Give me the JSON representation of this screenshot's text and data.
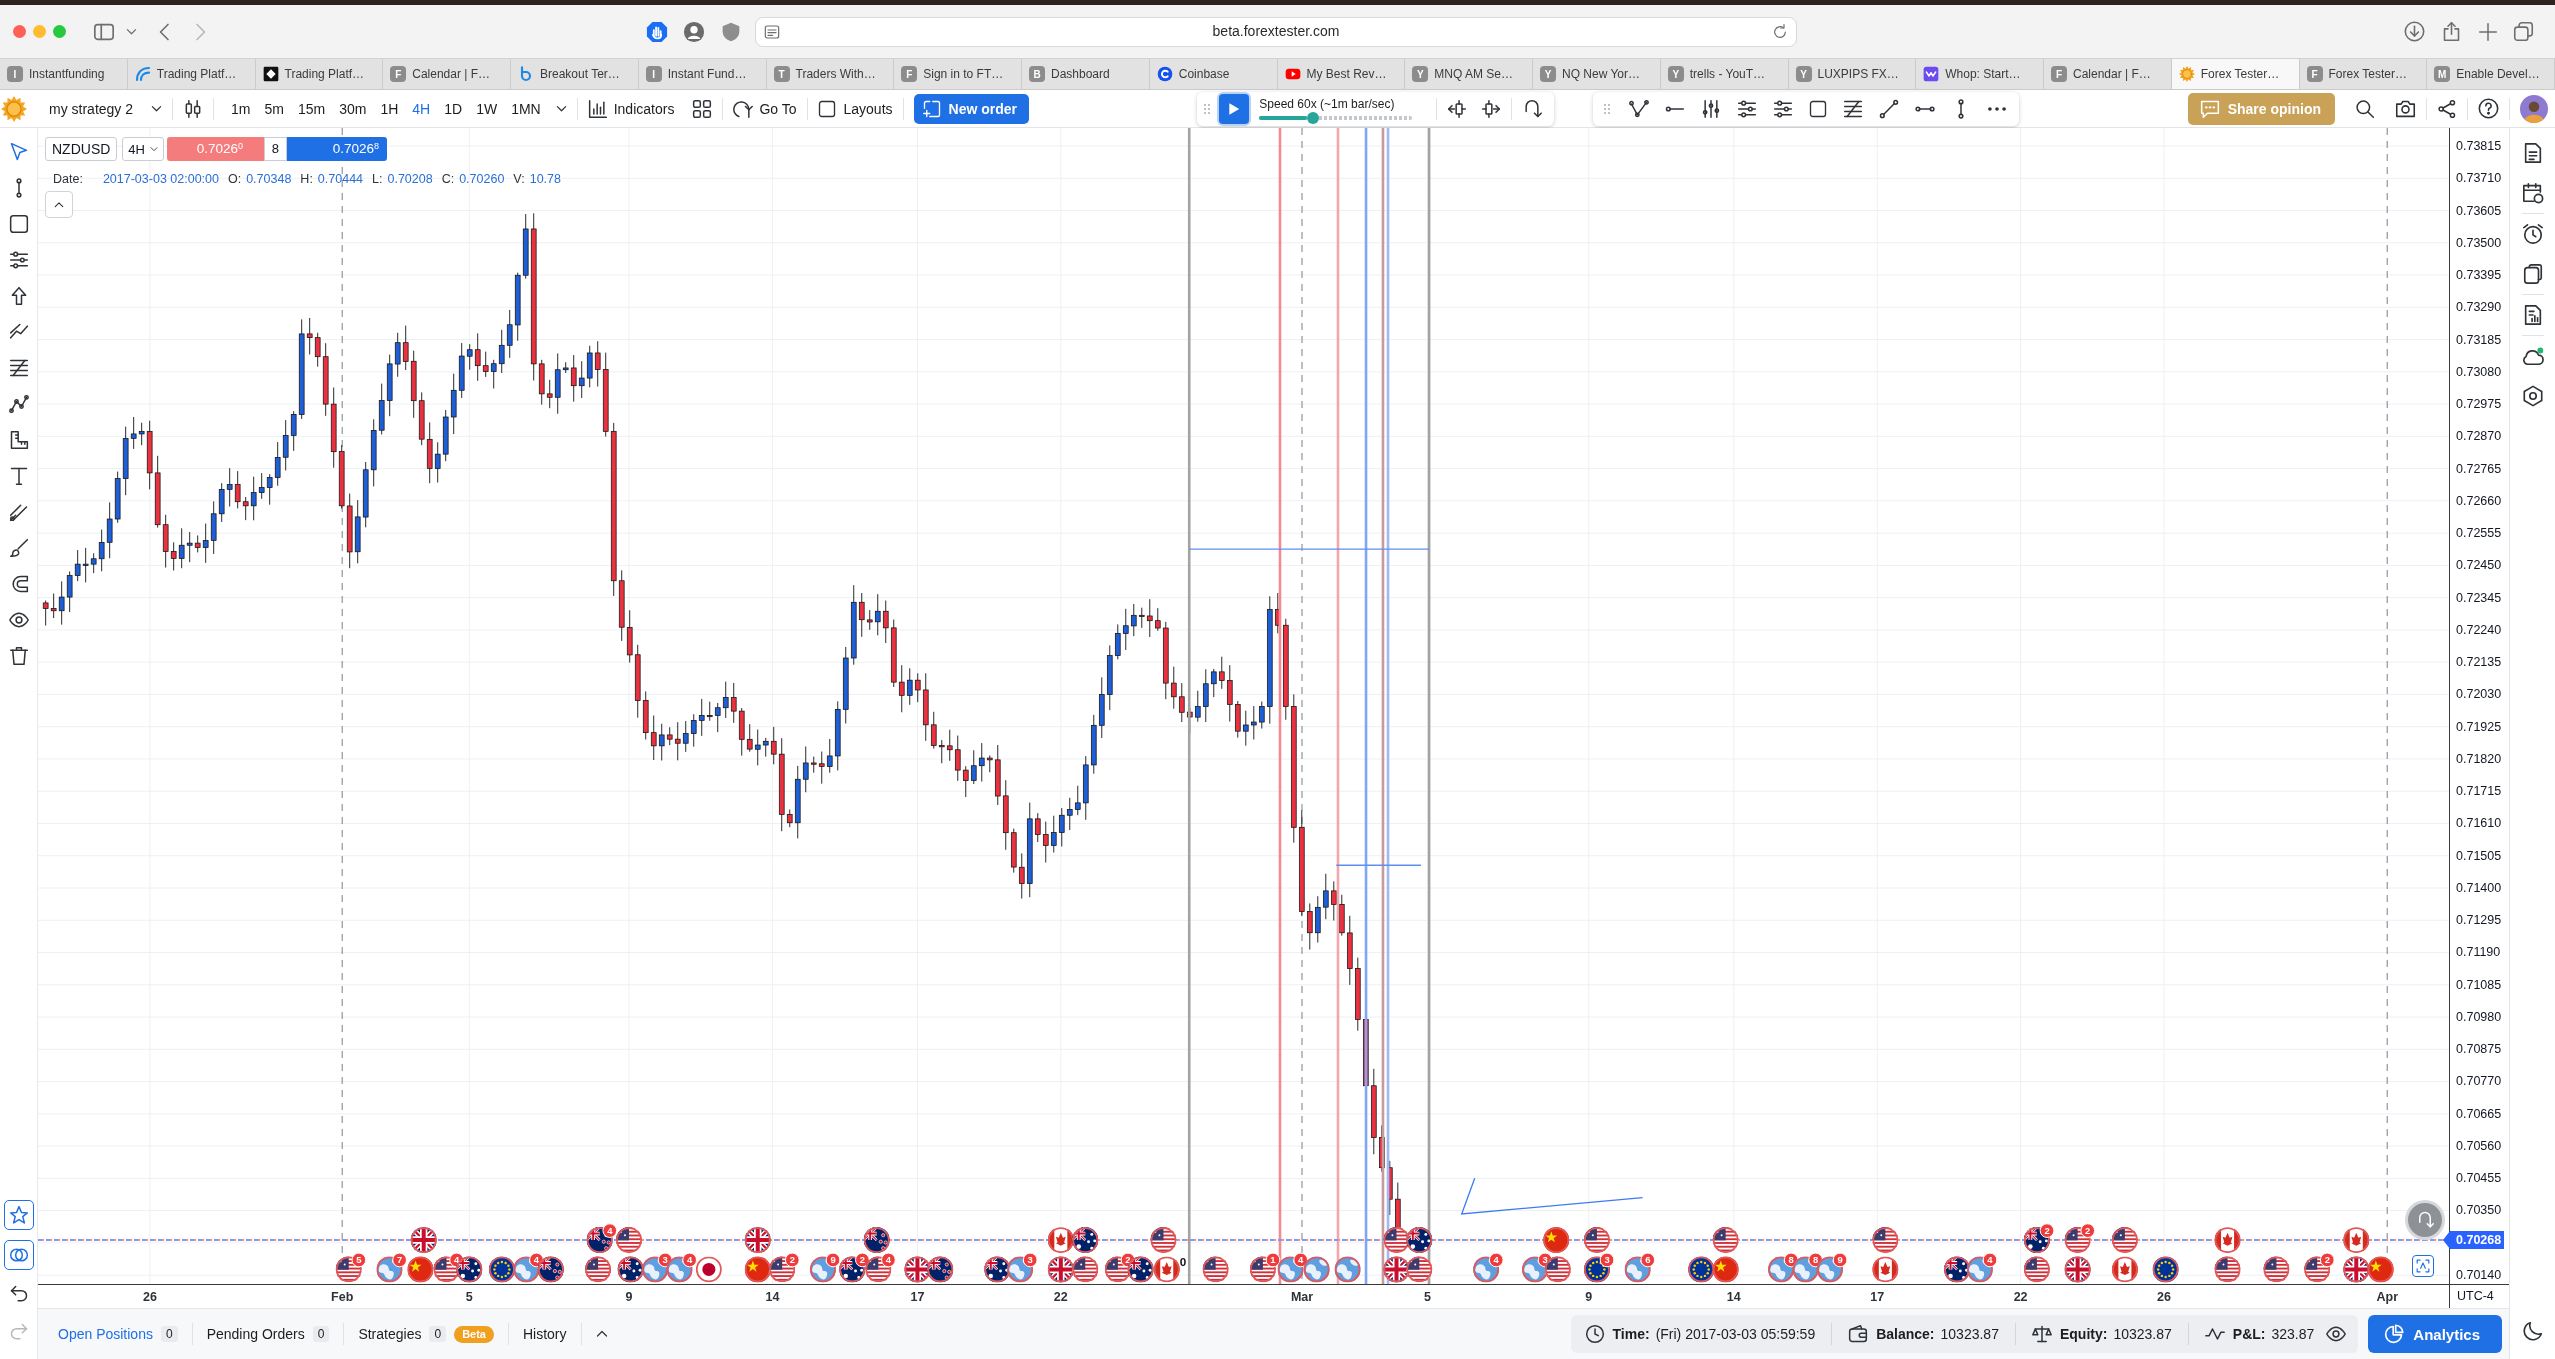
{
  "browser": {
    "address": "beta.forextester.com",
    "tabs": [
      {
        "label": "Instantfunding",
        "kind": "letter",
        "favicon_letter": "I",
        "selected": false
      },
      {
        "label": "Trading Platf…",
        "kind": "logo",
        "selected": false
      },
      {
        "label": "Trading Platf…",
        "kind": "logo",
        "selected": false
      },
      {
        "label": "Calendar | F…",
        "kind": "letter",
        "favicon_letter": "F",
        "selected": false
      },
      {
        "label": "Breakout Ter…",
        "kind": "logo",
        "selected": false
      },
      {
        "label": "Instant Fund…",
        "kind": "letter",
        "favicon_letter": "I",
        "selected": false
      },
      {
        "label": "Traders With…",
        "kind": "letter",
        "favicon_letter": "T",
        "selected": false
      },
      {
        "label": "Sign in to FT…",
        "kind": "letter",
        "favicon_letter": "F",
        "selected": false
      },
      {
        "label": "Dashboard",
        "kind": "letter",
        "favicon_letter": "B",
        "selected": false
      },
      {
        "label": "Coinbase",
        "kind": "logo",
        "selected": false
      },
      {
        "label": "My Best Rev…",
        "kind": "logo",
        "selected": false
      },
      {
        "label": "MNQ AM Se…",
        "kind": "letter",
        "favicon_letter": "Y",
        "selected": false
      },
      {
        "label": "NQ New Yor…",
        "kind": "letter",
        "favicon_letter": "Y",
        "selected": false
      },
      {
        "label": "trells - YouT…",
        "kind": "letter",
        "favicon_letter": "Y",
        "selected": false
      },
      {
        "label": "LUXPIPS FX…",
        "kind": "letter",
        "favicon_letter": "Y",
        "selected": false
      },
      {
        "label": "Whop: Start…",
        "kind": "logo",
        "selected": false
      },
      {
        "label": "Calendar | F…",
        "kind": "letter",
        "favicon_letter": "F",
        "selected": false
      },
      {
        "label": "Forex Tester…",
        "kind": "logo",
        "selected": true
      },
      {
        "label": "Forex Tester…",
        "kind": "letter",
        "favicon_letter": "F",
        "selected": false
      },
      {
        "label": "Enable Devel…",
        "kind": "letter",
        "favicon_letter": "M",
        "selected": false
      }
    ]
  },
  "toolbar": {
    "strategy": "my strategy 2",
    "timeframes": [
      {
        "label": "1m",
        "selected": false
      },
      {
        "label": "5m",
        "selected": false
      },
      {
        "label": "15m",
        "selected": false
      },
      {
        "label": "30m",
        "selected": false
      },
      {
        "label": "1H",
        "selected": false
      },
      {
        "label": "4H",
        "selected": true
      },
      {
        "label": "1D",
        "selected": false
      },
      {
        "label": "1W",
        "selected": false
      },
      {
        "label": "1MN",
        "selected": false
      }
    ],
    "indicators": "Indicators",
    "go_to": "Go To",
    "layouts": "Layouts",
    "new_order": "New order",
    "playback": {
      "speed": "Speed 60x (~1m bar/sec)",
      "level": 0.35
    },
    "share_opinion": "Share opinion"
  },
  "left_toolbar": {
    "tools": [
      {
        "selected": true
      },
      {
        "selected": false
      },
      {
        "selected": false
      },
      {
        "selected": false
      },
      {
        "selected": false
      },
      {
        "selected": false
      },
      {
        "selected": false
      },
      {
        "selected": false
      },
      {
        "selected": false
      },
      {
        "selected": false
      },
      {
        "selected": false
      },
      {
        "selected": false
      },
      {
        "selected": false
      },
      {
        "selected": false
      },
      {
        "selected": false
      }
    ],
    "toggles": [
      {
        "on": true
      },
      {
        "on": true
      }
    ],
    "history": [
      {
        "disabled": false
      },
      {
        "disabled": true
      }
    ]
  },
  "chart": {
    "symbol": "NZDUSD",
    "timeframe": "4H",
    "sell_price": "0.7026$^{0}$",
    "spread": "8",
    "buy_price": "0.7026$^{8}$",
    "ohlc": [
      {
        "label": "Date:",
        "value": "2017-03-03 02:00:00"
      },
      {
        "label": "O:",
        "value": "0.70348"
      },
      {
        "label": "H:",
        "value": "0.70444"
      },
      {
        "label": "L:",
        "value": "0.70208"
      },
      {
        "label": "C:",
        "value": "0.70260"
      },
      {
        "label": "V:",
        "value": "10.78"
      }
    ],
    "price_axis": [
      "0.73815",
      "0.73710",
      "0.73605",
      "0.73500",
      "0.73395",
      "0.73290",
      "0.73185",
      "0.73080",
      "0.72975",
      "0.72870",
      "0.72765",
      "0.72660",
      "0.72555",
      "0.72450",
      "0.72345",
      "0.72240",
      "0.72135",
      "0.72030",
      "0.71925",
      "0.71820",
      "0.71715",
      "0.71610",
      "0.71505",
      "0.71400",
      "0.71295",
      "0.71190",
      "0.71085",
      "0.70980",
      "0.70875",
      "0.70770",
      "0.70665",
      "0.70560",
      "0.70455",
      "0.70350",
      "0.70140"
    ],
    "current_price": "0.70268",
    "date_axis": [
      "26",
      "Feb",
      "5",
      "9",
      "14",
      "17",
      "22",
      "Mar",
      "5",
      "9",
      "14",
      "17",
      "22",
      "26",
      "Apr"
    ],
    "timezone": "UTC-4",
    "line_labels": [
      {
        "text": "0",
        "color": "#111111"
      }
    ],
    "events": {
      "upper_row": [
        {
          "kind": "uk"
        },
        {
          "kind": "nz",
          "count": "4"
        },
        {
          "kind": "us"
        },
        {
          "kind": "uk"
        },
        {
          "kind": "nz"
        },
        {
          "kind": "ca"
        },
        {
          "kind": "au"
        },
        {
          "kind": "us"
        },
        {
          "kind": "us"
        },
        {
          "kind": "au"
        },
        {
          "kind": "cn"
        },
        {
          "kind": "us"
        },
        {
          "kind": "us"
        },
        {
          "kind": "us"
        },
        {
          "kind": "au",
          "count": "2"
        },
        {
          "kind": "us",
          "count": "2"
        },
        {
          "kind": "us"
        },
        {
          "kind": "ca"
        },
        {
          "kind": "ca"
        }
      ],
      "lower_row": [
        {
          "kind": "us",
          "count": "5"
        },
        {
          "kind": "world",
          "count": "7"
        },
        {
          "kind": "cn"
        },
        {
          "kind": "us",
          "count": "4"
        },
        {
          "kind": "au"
        },
        {
          "kind": "eu"
        },
        {
          "kind": "world",
          "count": "4"
        },
        {
          "kind": "nz"
        },
        {
          "kind": "us"
        },
        {
          "kind": "au"
        },
        {
          "kind": "world",
          "count": "3"
        },
        {
          "kind": "world",
          "count": "4"
        },
        {
          "kind": "jp"
        },
        {
          "kind": "cn"
        },
        {
          "kind": "us",
          "count": "2"
        },
        {
          "kind": "world",
          "count": "9"
        },
        {
          "kind": "au",
          "count": "2"
        },
        {
          "kind": "us",
          "count": "4"
        },
        {
          "kind": "uk"
        },
        {
          "kind": "nz"
        },
        {
          "kind": "au"
        },
        {
          "kind": "world",
          "count": "3"
        },
        {
          "kind": "uk"
        },
        {
          "kind": "us"
        },
        {
          "kind": "us",
          "count": "2"
        },
        {
          "kind": "au"
        },
        {
          "kind": "ca"
        },
        {
          "kind": "us"
        },
        {
          "kind": "us",
          "count": "1"
        },
        {
          "kind": "world",
          "count": "4"
        },
        {
          "kind": "world"
        },
        {
          "kind": "world"
        },
        {
          "kind": "uk"
        },
        {
          "kind": "us"
        },
        {
          "kind": "world",
          "count": "4"
        },
        {
          "kind": "world",
          "count": "3"
        },
        {
          "kind": "us"
        },
        {
          "kind": "eu",
          "count": "3"
        },
        {
          "kind": "world",
          "count": "6"
        },
        {
          "kind": "eu"
        },
        {
          "kind": "cn"
        },
        {
          "kind": "world",
          "count": "8"
        },
        {
          "kind": "world",
          "count": "8"
        },
        {
          "kind": "world",
          "count": "9"
        },
        {
          "kind": "ca"
        },
        {
          "kind": "au"
        },
        {
          "kind": "world",
          "count": "4"
        },
        {
          "kind": "us"
        },
        {
          "kind": "uk"
        },
        {
          "kind": "ca"
        },
        {
          "kind": "eu"
        },
        {
          "kind": "us"
        },
        {
          "kind": "us"
        },
        {
          "kind": "us",
          "count": "2"
        },
        {
          "kind": "uk"
        },
        {
          "kind": "cn"
        }
      ]
    }
  },
  "bottom_bar": {
    "tabs": [
      {
        "label": "Open Positions",
        "count": "0",
        "selected": true
      },
      {
        "label": "Pending Orders",
        "count": "0",
        "selected": false
      },
      {
        "label": "Strategies",
        "count": "0",
        "tag": "Beta",
        "selected": false
      },
      {
        "label": "History",
        "selected": false
      }
    ],
    "stats": [
      {
        "label": "Time:",
        "value": "(Fri) 2017-03-03 05:59:59"
      },
      {
        "label": "Balance:",
        "value": "10323.87"
      },
      {
        "label": "Equity:",
        "value": "10323.87"
      },
      {
        "label": "P&L:",
        "value": "323.87"
      }
    ],
    "analytics": "Analytics"
  }
}
